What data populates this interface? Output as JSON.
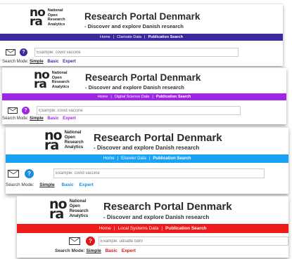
{
  "logo": {
    "mark_top": "no",
    "mark_bottom": "ra",
    "lines": [
      "National",
      "Open",
      "Research",
      "Analytics"
    ]
  },
  "title": "Research Portal Denmark",
  "subtitle": "- Discover and explore Danish research",
  "search_mode_label": "Search Mode:",
  "modes": [
    "Simple",
    "Basic",
    "Expert"
  ],
  "help_label": "?",
  "panels": [
    {
      "nav": [
        "Home",
        "Clarivate Data",
        "Publication Search"
      ],
      "nav_color": "#3a2a9e",
      "accent": "#3a2a9e",
      "help_color": "#3a2a9e",
      "placeholder": "Example: covid vaccine"
    },
    {
      "nav": [
        "Home",
        "Digital Science Data",
        "Publication Search"
      ],
      "nav_color": "#a125e8",
      "accent": "#a125e8",
      "help_color": "#a125e8",
      "placeholder": "Example: covid vaccine"
    },
    {
      "nav": [
        "Home",
        "Elsevier Data",
        "Publication Search"
      ],
      "nav_color": "#1aa3f5",
      "accent": "#1a8fe0",
      "help_color": "#1a8fe0",
      "placeholder": "Example: covid vaccine"
    },
    {
      "nav": [
        "Home",
        "Local Systems Data",
        "Publication Search"
      ],
      "nav_color": "#ef1a1a",
      "accent": "#e01414",
      "help_color": "#e01414",
      "placeholder": "Example: udsatte børn"
    }
  ]
}
